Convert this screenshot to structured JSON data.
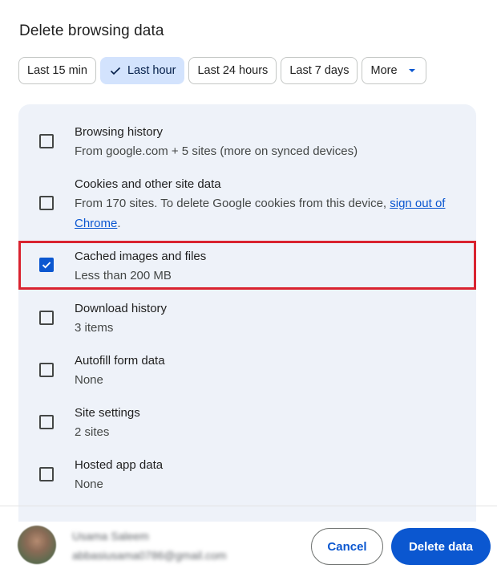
{
  "dialog": {
    "title": "Delete browsing data"
  },
  "time_range": {
    "chips": [
      {
        "label": "Last 15 min",
        "selected": false
      },
      {
        "label": "Last hour",
        "selected": true
      },
      {
        "label": "Last 24 hours",
        "selected": false
      },
      {
        "label": "Last 7 days",
        "selected": false
      }
    ],
    "more_label": "More"
  },
  "items": [
    {
      "label": "Browsing history",
      "desc": "From google.com + 5 sites (more on synced devices)",
      "checked": false
    },
    {
      "label": "Cookies and other site data",
      "desc_prefix": "From 170 sites. To delete Google cookies from this device, ",
      "desc_link": "sign out of Chrome",
      "desc_suffix": ".",
      "checked": false
    },
    {
      "label": "Cached images and files",
      "desc": "Less than 200 MB",
      "checked": true
    },
    {
      "label": "Download history",
      "desc": "3 items",
      "checked": false
    },
    {
      "label": "Autofill form data",
      "desc": "None",
      "checked": false
    },
    {
      "label": "Site settings",
      "desc": "2 sites",
      "checked": false
    },
    {
      "label": "Hosted app data",
      "desc": "None",
      "checked": false
    }
  ],
  "account": {
    "name": "Usama Saleem",
    "email": "abbasiusama0786@gmail.com"
  },
  "actions": {
    "cancel_label": "Cancel",
    "delete_label": "Delete data"
  },
  "colors": {
    "accent": "#0b57d0",
    "chip_selected_bg": "#d3e3fd",
    "panel_bg": "#eef2f9",
    "highlight_border": "#d92330"
  }
}
